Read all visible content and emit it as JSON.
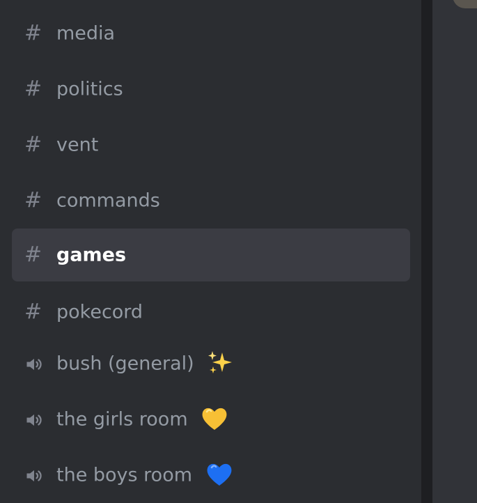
{
  "channels": [
    {
      "type": "text",
      "name": "media",
      "selected": false
    },
    {
      "type": "text",
      "name": "politics",
      "selected": false
    },
    {
      "type": "text",
      "name": "vent",
      "selected": false
    },
    {
      "type": "text",
      "name": "commands",
      "selected": false
    },
    {
      "type": "text",
      "name": "games",
      "selected": true
    },
    {
      "type": "text",
      "name": "pokecord",
      "selected": false
    },
    {
      "type": "voice",
      "name": "bush (general)",
      "emoji": "sparkles-emoji",
      "selected": false
    },
    {
      "type": "voice",
      "name": "the girls room",
      "emoji": "yellow-heart-emoji",
      "selected": false
    },
    {
      "type": "voice",
      "name": "the boys room",
      "emoji": "blue-heart-emoji",
      "selected": false
    }
  ],
  "glyphs": {
    "hash": "#"
  },
  "colors": {
    "sidebar_bg": "#2b2d31",
    "selected_bg": "#3b3c43",
    "text_muted": "#949ba4",
    "text_selected": "#ffffff",
    "icon_muted": "#80848e",
    "divider": "#1e1f22",
    "yellow_heart": "#f7c035",
    "blue_heart": "#1d6ff2",
    "sparkle": "#fcd24a"
  }
}
